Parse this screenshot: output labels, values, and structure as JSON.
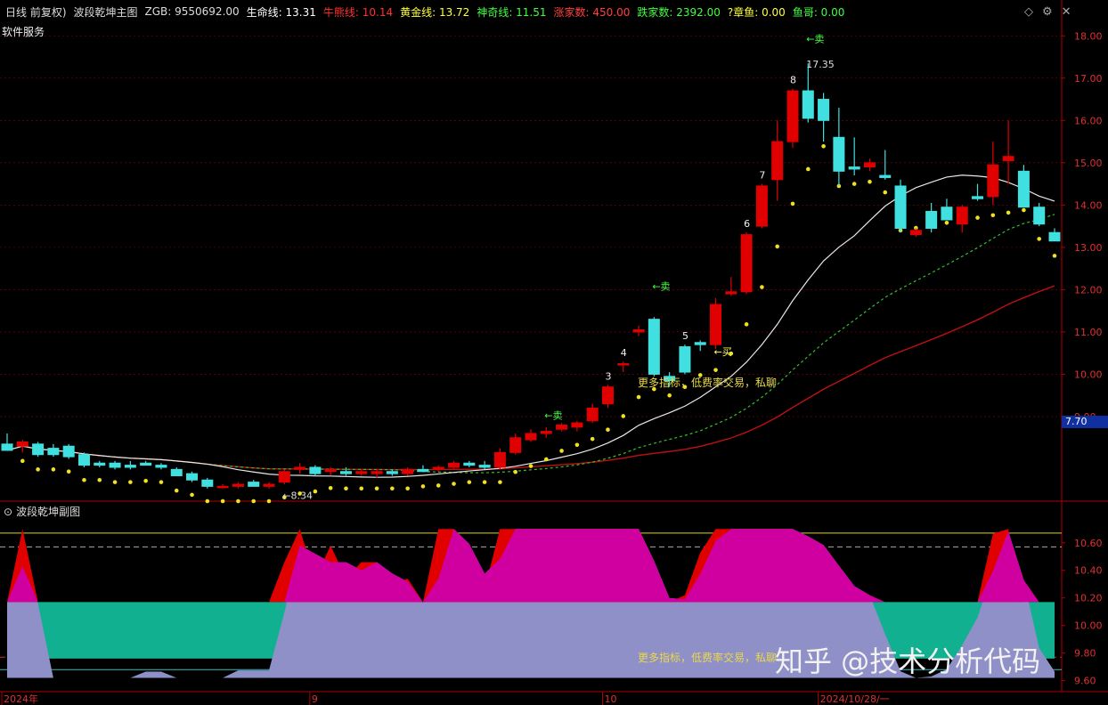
{
  "header": {
    "items": [
      {
        "label": "日线 前复权)",
        "color": "#dddddd"
      },
      {
        "label": "波段乾坤主图",
        "color": "#dddddd"
      },
      {
        "label": "ZGB: 9550692.00",
        "color": "#dddddd"
      },
      {
        "label": "生命线: 13.31",
        "color": "#ffffff"
      },
      {
        "label": "牛熊线: 10.14",
        "color": "#ff3030"
      },
      {
        "label": "黄金线: 13.72",
        "color": "#ffff40"
      },
      {
        "label": "神奇线: 11.51",
        "color": "#40ff40"
      },
      {
        "label": "涨家数: 450.00",
        "color": "#ff4040"
      },
      {
        "label": "跌家数: 2392.00",
        "color": "#40ff40"
      },
      {
        "label": "?章鱼: 0.00",
        "color": "#ffff40"
      },
      {
        "label": "鱼哥: 0.00",
        "color": "#40ff40"
      }
    ]
  },
  "service_label": "软件服务",
  "sub_title": "波段乾坤副图",
  "promo_main": "更多指标，低费率交易，私聊",
  "promo_sub": "更多指标，低费率交易，私聊",
  "watermark": "知乎 @技术分析代码",
  "current_price_tag": "7.70",
  "colors": {
    "up": "#e00000",
    "down": "#40e0e0",
    "grid": "#8b0000",
    "axis": "#b00000"
  },
  "chart_data": [
    {
      "type": "candlestick",
      "title": "波段乾坤主图",
      "y_ticks": [
        "18.00",
        "17.00",
        "16.00",
        "15.00",
        "14.00",
        "13.00",
        "12.00",
        "11.00",
        "10.00",
        "9.00"
      ],
      "ylim": [
        7.0,
        18.3
      ],
      "x_ticks": [
        "2024年",
        "9",
        "10",
        "2024/10/28/一"
      ],
      "x_tick_index": [
        0,
        20,
        39,
        53
      ],
      "candles": [
        {
          "o": 8.35,
          "h": 8.6,
          "l": 8.2,
          "c": 8.2
        },
        {
          "o": 8.3,
          "h": 8.45,
          "l": 8.15,
          "c": 8.4
        },
        {
          "o": 8.35,
          "h": 8.4,
          "l": 8.05,
          "c": 8.1
        },
        {
          "o": 8.25,
          "h": 8.35,
          "l": 8.05,
          "c": 8.1
        },
        {
          "o": 8.3,
          "h": 8.35,
          "l": 8.0,
          "c": 8.05
        },
        {
          "o": 8.1,
          "h": 8.15,
          "l": 7.8,
          "c": 7.85
        },
        {
          "o": 7.9,
          "h": 7.95,
          "l": 7.8,
          "c": 7.85
        },
        {
          "o": 7.9,
          "h": 7.95,
          "l": 7.75,
          "c": 7.8
        },
        {
          "o": 7.85,
          "h": 7.95,
          "l": 7.75,
          "c": 7.8
        },
        {
          "o": 7.9,
          "h": 7.95,
          "l": 7.85,
          "c": 7.85
        },
        {
          "o": 7.85,
          "h": 7.9,
          "l": 7.75,
          "c": 7.8
        },
        {
          "o": 7.75,
          "h": 7.8,
          "l": 7.6,
          "c": 7.6
        },
        {
          "o": 7.65,
          "h": 7.7,
          "l": 7.45,
          "c": 7.5
        },
        {
          "o": 7.5,
          "h": 7.55,
          "l": 7.3,
          "c": 7.35
        },
        {
          "o": 7.35,
          "h": 7.4,
          "l": 7.3,
          "c": 7.35
        },
        {
          "o": 7.35,
          "h": 7.45,
          "l": 7.3,
          "c": 7.4
        },
        {
          "o": 7.45,
          "h": 7.5,
          "l": 7.35,
          "c": 7.35
        },
        {
          "o": 7.35,
          "h": 7.45,
          "l": 7.3,
          "c": 7.4
        },
        {
          "o": 7.45,
          "h": 7.75,
          "l": 7.4,
          "c": 7.7
        },
        {
          "o": 7.75,
          "h": 7.9,
          "l": 7.65,
          "c": 7.8
        },
        {
          "o": 7.8,
          "h": 7.85,
          "l": 7.6,
          "c": 7.65
        },
        {
          "o": 7.7,
          "h": 7.8,
          "l": 7.6,
          "c": 7.75
        },
        {
          "o": 7.7,
          "h": 7.8,
          "l": 7.6,
          "c": 7.65
        },
        {
          "o": 7.65,
          "h": 7.75,
          "l": 7.6,
          "c": 7.7
        },
        {
          "o": 7.65,
          "h": 7.75,
          "l": 7.55,
          "c": 7.7
        },
        {
          "o": 7.7,
          "h": 7.75,
          "l": 7.6,
          "c": 7.65
        },
        {
          "o": 7.65,
          "h": 7.8,
          "l": 7.6,
          "c": 7.75
        },
        {
          "o": 7.75,
          "h": 7.85,
          "l": 7.7,
          "c": 7.7
        },
        {
          "o": 7.75,
          "h": 7.85,
          "l": 7.7,
          "c": 7.8
        },
        {
          "o": 7.8,
          "h": 7.95,
          "l": 7.75,
          "c": 7.9
        },
        {
          "o": 7.9,
          "h": 7.95,
          "l": 7.8,
          "c": 7.85
        },
        {
          "o": 7.85,
          "h": 7.95,
          "l": 7.75,
          "c": 7.8
        },
        {
          "o": 7.8,
          "h": 8.25,
          "l": 7.75,
          "c": 8.15
        },
        {
          "o": 8.15,
          "h": 8.6,
          "l": 8.1,
          "c": 8.5
        },
        {
          "o": 8.45,
          "h": 8.7,
          "l": 8.4,
          "c": 8.6
        },
        {
          "o": 8.6,
          "h": 8.75,
          "l": 8.5,
          "c": 8.65
        },
        {
          "o": 8.7,
          "h": 8.85,
          "l": 8.65,
          "c": 8.8
        },
        {
          "o": 8.75,
          "h": 8.9,
          "l": 8.65,
          "c": 8.85
        },
        {
          "o": 8.9,
          "h": 9.3,
          "l": 8.85,
          "c": 9.2
        },
        {
          "o": 9.3,
          "h": 9.75,
          "l": 9.2,
          "c": 9.7
        },
        {
          "o": 10.25,
          "h": 10.3,
          "l": 10.05,
          "c": 10.25
        },
        {
          "o": 11.0,
          "h": 11.15,
          "l": 10.9,
          "c": 11.05
        },
        {
          "o": 11.3,
          "h": 11.35,
          "l": 9.95,
          "c": 10.0
        },
        {
          "o": 9.95,
          "h": 10.05,
          "l": 9.7,
          "c": 9.85
        },
        {
          "o": 10.65,
          "h": 10.7,
          "l": 10.0,
          "c": 10.05
        },
        {
          "o": 10.75,
          "h": 10.8,
          "l": 10.55,
          "c": 10.7
        },
        {
          "o": 10.7,
          "h": 11.8,
          "l": 10.6,
          "c": 11.65
        },
        {
          "o": 11.9,
          "h": 12.3,
          "l": 11.85,
          "c": 11.95
        },
        {
          "o": 11.95,
          "h": 13.35,
          "l": 11.9,
          "c": 13.3
        },
        {
          "o": 13.5,
          "h": 14.5,
          "l": 13.45,
          "c": 14.45
        },
        {
          "o": 14.6,
          "h": 16.0,
          "l": 14.1,
          "c": 15.5
        },
        {
          "o": 15.5,
          "h": 16.75,
          "l": 15.35,
          "c": 16.7
        },
        {
          "o": 16.7,
          "h": 17.35,
          "l": 15.95,
          "c": 16.05
        },
        {
          "o": 16.5,
          "h": 16.65,
          "l": 15.5,
          "c": 16.0
        },
        {
          "o": 15.6,
          "h": 16.3,
          "l": 14.45,
          "c": 14.8
        },
        {
          "o": 14.9,
          "h": 15.6,
          "l": 14.7,
          "c": 14.85
        },
        {
          "o": 14.9,
          "h": 15.1,
          "l": 14.8,
          "c": 15.0
        },
        {
          "o": 14.7,
          "h": 15.3,
          "l": 14.6,
          "c": 14.65
        },
        {
          "o": 14.45,
          "h": 14.6,
          "l": 13.35,
          "c": 13.45
        },
        {
          "o": 13.3,
          "h": 13.45,
          "l": 13.25,
          "c": 13.4
        },
        {
          "o": 13.85,
          "h": 14.05,
          "l": 13.35,
          "c": 13.45
        },
        {
          "o": 13.95,
          "h": 14.15,
          "l": 13.65,
          "c": 13.65
        },
        {
          "o": 13.55,
          "h": 14.0,
          "l": 13.35,
          "c": 13.95
        },
        {
          "o": 14.2,
          "h": 14.5,
          "l": 14.1,
          "c": 14.15
        },
        {
          "o": 14.2,
          "h": 15.5,
          "l": 14.0,
          "c": 14.95
        },
        {
          "o": 15.05,
          "h": 16.0,
          "l": 14.5,
          "c": 15.15
        },
        {
          "o": 14.8,
          "h": 14.95,
          "l": 13.95,
          "c": 13.95
        },
        {
          "o": 13.95,
          "h": 14.05,
          "l": 13.5,
          "c": 13.55
        },
        {
          "o": 13.35,
          "h": 13.45,
          "l": 13.15,
          "c": 13.15
        }
      ],
      "labels": [
        {
          "i": 39,
          "text": "3"
        },
        {
          "i": 40,
          "text": "4"
        },
        {
          "i": 44,
          "text": "5"
        },
        {
          "i": 48,
          "text": "6"
        },
        {
          "i": 49,
          "text": "7"
        },
        {
          "i": 51,
          "text": "8"
        }
      ],
      "signals": [
        {
          "i": 35,
          "text": "←卖",
          "price": 8.95
        },
        {
          "i": 42,
          "text": "←卖",
          "price": 12.0
        },
        {
          "i": 52,
          "text": "←卖",
          "price": 17.85
        },
        {
          "i": 46,
          "text": "←买",
          "price": 10.45
        },
        {
          "i": 18,
          "text": "←8.34",
          "price": 7.05
        },
        {
          "i": 52,
          "text": "17.35",
          "price": 17.25
        }
      ]
    },
    {
      "type": "area",
      "title": "波段乾坤副图",
      "y_ticks": [
        "10.60",
        "10.40",
        "10.20",
        "10.00",
        "9.80",
        "9.60"
      ],
      "ylim": [
        9.52,
        10.76
      ]
    }
  ]
}
